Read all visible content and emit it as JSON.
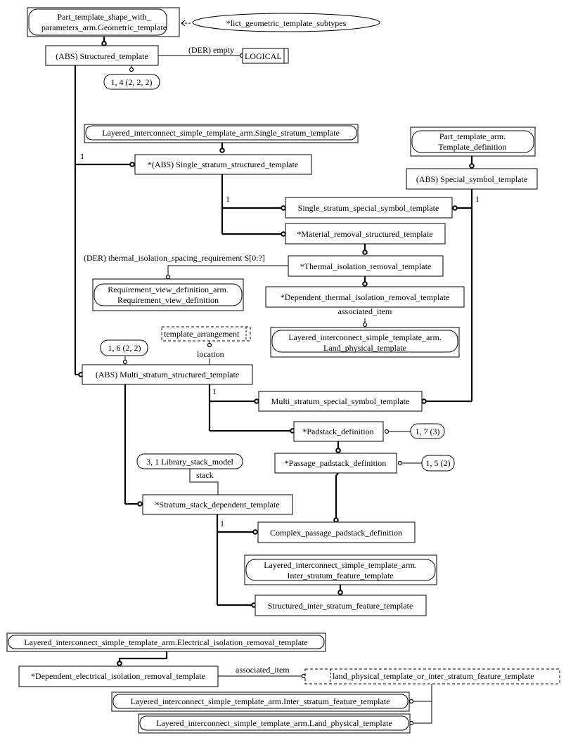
{
  "diagram": {
    "type": "EXPRESS-G",
    "entities": {
      "geometric_template": [
        "Part_template_shape_with_",
        "parameters_arm.Geometric_template"
      ],
      "lict_subtypes": "*lict_geometric_template_subtypes",
      "structured_template": "(ABS) Structured_template",
      "der_empty": "(DER) empty",
      "logical": "LOGICAL",
      "ref_1_4": "1, 4 (2, 2, 2)",
      "single_stratum_template": "Layered_interconnect_simple_template_arm.Single_stratum_template",
      "single_stratum_structured": "*(ABS) Single_stratum_structured_template",
      "template_definition": [
        "Part_template_arm.",
        "Template_definition"
      ],
      "special_symbol_template": "(ABS) Special_symbol_template",
      "single_stratum_special_symbol": "Single_stratum_special_symbol_template",
      "material_removal": "*Material_removal_structured_template",
      "der_thermal": "(DER) thermal_isolation_spacing_requirement S[0:?]",
      "thermal_isolation_removal": "*Thermal_isolation_removal_template",
      "requirement_view_definition": [
        "Requirement_view_definition_arm.",
        "Requirement_view_definition"
      ],
      "dependent_thermal": "*Dependent_thermal_isolation_removal_template",
      "associated_item_1": "associated_item",
      "land_physical_template": [
        "Layered_interconnect_simple_template_arm.",
        "Land_physical_template"
      ],
      "template_arrangement": "template_arrangement",
      "location": "location",
      "ref_1_6": "1, 6 (2, 2)",
      "multi_stratum_structured": "(ABS) Multi_stratum_structured_template",
      "multi_stratum_special_symbol": "Multi_stratum_special_symbol_template",
      "padstack_definition": "*Padstack_definition",
      "ref_1_7": "1, 7 (3)",
      "passage_padstack": "*Passage_padstack_definition",
      "ref_1_5": "1, 5 (2)",
      "library_stack_model": "3, 1 Library_stack_model",
      "stack": "stack",
      "stratum_stack_dependent": "*Stratum_stack_dependent_template",
      "complex_passage_padstack": "Complex_passage_padstack_definition",
      "inter_stratum_feature": [
        "Layered_interconnect_simple_template_arm.",
        "Inter_stratum_feature_template"
      ],
      "structured_inter_stratum": "Structured_inter_stratum_feature_template",
      "electrical_isolation_removal": "Layered_interconnect_simple_template_arm.Electrical_isolation_removal_template",
      "dependent_electrical": "*Dependent_electrical_isolation_removal_template",
      "associated_item_2": "associated_item",
      "land_or_inter_select": "land_physical_template_or_inter_stratum_feature_template",
      "inter_stratum_feature_full": "Layered_interconnect_simple_template_arm.Inter_stratum_feature_template",
      "land_physical_full": "Layered_interconnect_simple_template_arm.Land_physical_template",
      "one": "1"
    }
  }
}
